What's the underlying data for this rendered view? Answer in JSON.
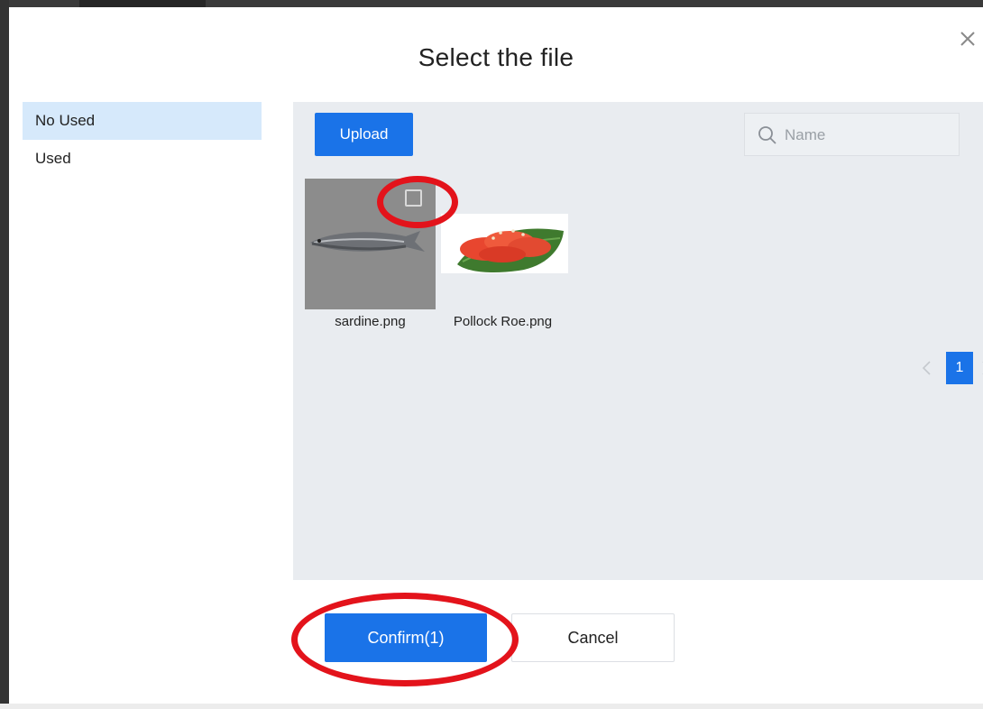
{
  "dialog": {
    "title": "Select the file",
    "close_icon": "close-icon"
  },
  "sidebar": {
    "items": [
      {
        "label": "No Used",
        "active": true
      },
      {
        "label": "Used",
        "active": false
      }
    ]
  },
  "toolbar": {
    "upload_label": "Upload",
    "search_placeholder": "Name",
    "search_value": ""
  },
  "files": [
    {
      "name": "sardine.png",
      "checked": false
    },
    {
      "name": "Pollock Roe.png"
    }
  ],
  "pagination": {
    "current_page": "1"
  },
  "footer": {
    "confirm_label": "Confirm(1)",
    "cancel_label": "Cancel"
  },
  "colors": {
    "primary": "#1a73e8",
    "active_item_bg": "#d6e9fb",
    "panel_bg": "#e9ecf0",
    "annotation": "#e3131b"
  }
}
